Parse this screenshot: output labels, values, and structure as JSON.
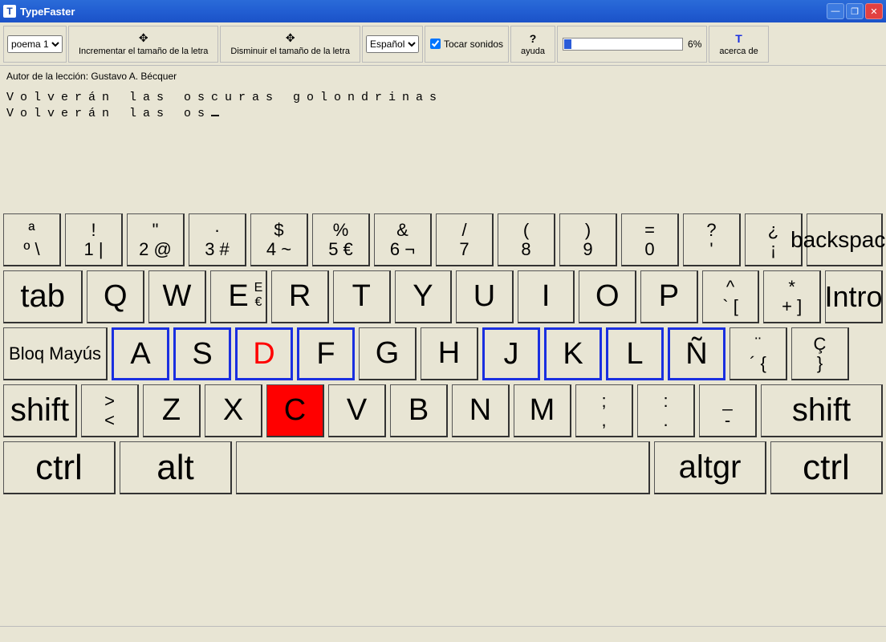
{
  "window": {
    "title": "TypeFaster",
    "icon_letter": "T"
  },
  "toolbar": {
    "lesson_select": "poema 1",
    "increase_font": "Incrementar el tamaño de la letra",
    "decrease_font": "Disminuir el tamaño de la letra",
    "language_select": "Español",
    "play_sounds": "Tocar sonidos",
    "help": "ayuda",
    "about": "acerca de",
    "about_icon": "T",
    "progress_pct": "6%",
    "progress_value": 6
  },
  "lesson": {
    "author_label": "Autor de la lección: Gustavo A. Bécquer",
    "target_text": "Volverán las oscuras golondrinas",
    "typed_text": "Volverán las os"
  },
  "keyboard": {
    "row0": [
      {
        "top": "ª",
        "bot": "º \\"
      },
      {
        "top": "!",
        "bot": "1 |"
      },
      {
        "top": "\"",
        "bot": "2 @"
      },
      {
        "top": "·",
        "bot": "3 #"
      },
      {
        "top": "$",
        "bot": "4 ~"
      },
      {
        "top": "%",
        "bot": "5 €"
      },
      {
        "top": "&",
        "bot": "6 ¬"
      },
      {
        "top": "/",
        "bot": "7"
      },
      {
        "top": "(",
        "bot": "8"
      },
      {
        "top": ")",
        "bot": "9"
      },
      {
        "top": "=",
        "bot": "0"
      },
      {
        "top": "?",
        "bot": "'"
      },
      {
        "top": "¿",
        "bot": "¡"
      }
    ],
    "backspace": "backspace",
    "tab": "tab",
    "row1": [
      "Q",
      "W",
      "E",
      "R",
      "T",
      "Y",
      "U",
      "I",
      "O",
      "P"
    ],
    "row1_e_extra": "€",
    "row1_end": [
      {
        "top": "^",
        "bot": "` ["
      },
      {
        "top": "*",
        "bot": "+ ]"
      }
    ],
    "intro": "Intro",
    "caps": "Bloq Mayús",
    "row2": [
      "A",
      "S",
      "D",
      "F",
      "G",
      "H",
      "J",
      "K",
      "L",
      "Ñ"
    ],
    "row2_end": [
      {
        "top": "¨",
        "bot": "´ {"
      },
      {
        "top": "Ç",
        "bot": "}"
      }
    ],
    "shift": "shift",
    "row3_pre": {
      "top": ">",
      "bot": "<"
    },
    "row3": [
      "Z",
      "X",
      "C",
      "V",
      "B",
      "N",
      "M"
    ],
    "row3_end": [
      {
        "top": ";",
        "bot": ","
      },
      {
        "top": ":",
        "bot": "."
      },
      {
        "top": "_",
        "bot": "-"
      }
    ],
    "ctrl": "ctrl",
    "alt": "alt",
    "altgr": "altgr",
    "home_keys": [
      "A",
      "S",
      "D",
      "F",
      "J",
      "K",
      "L",
      "Ñ"
    ],
    "highlight_key": "C",
    "highlight_letter_key": "D"
  }
}
